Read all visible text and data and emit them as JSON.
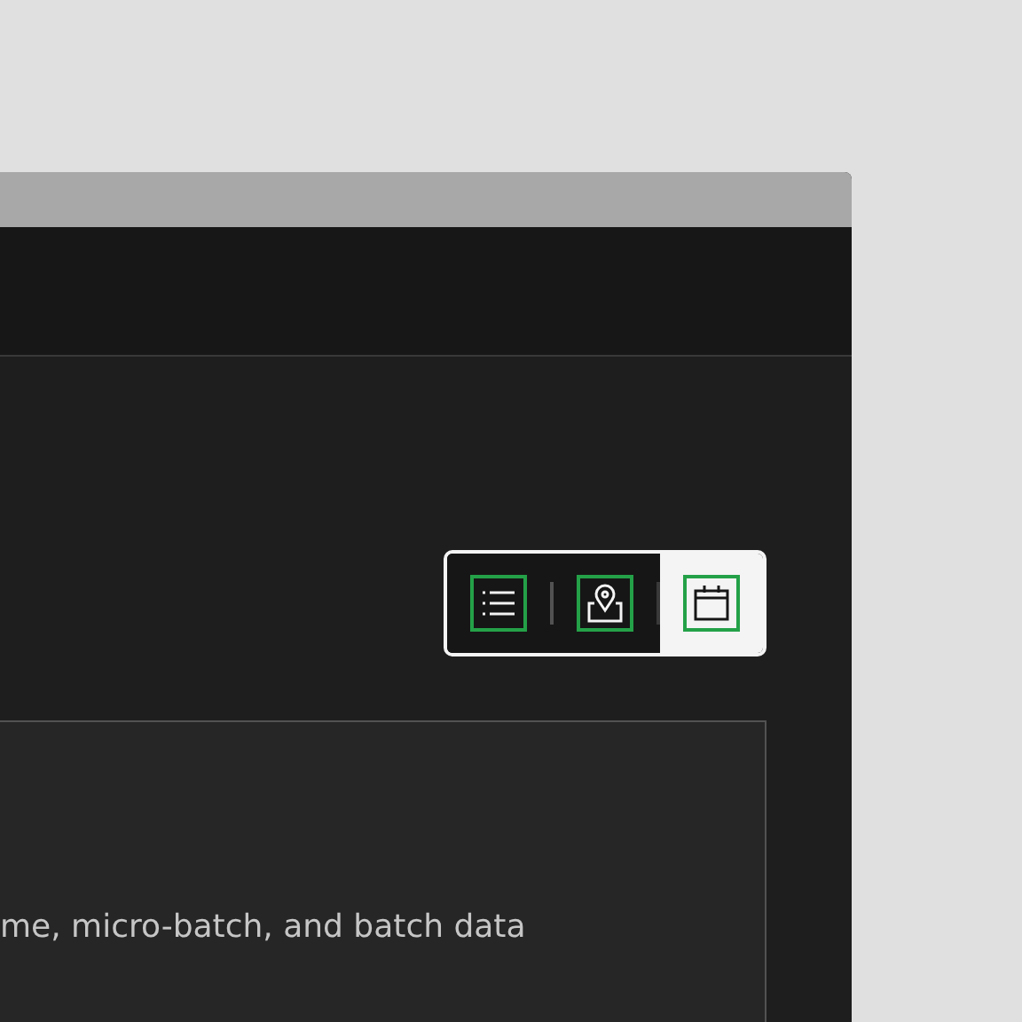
{
  "view_switcher": [
    {
      "kind": "list",
      "selected": false
    },
    {
      "kind": "map",
      "selected": false
    },
    {
      "kind": "calendar",
      "selected": true
    }
  ],
  "card": {
    "description": "me, micro-batch, and batch data"
  }
}
